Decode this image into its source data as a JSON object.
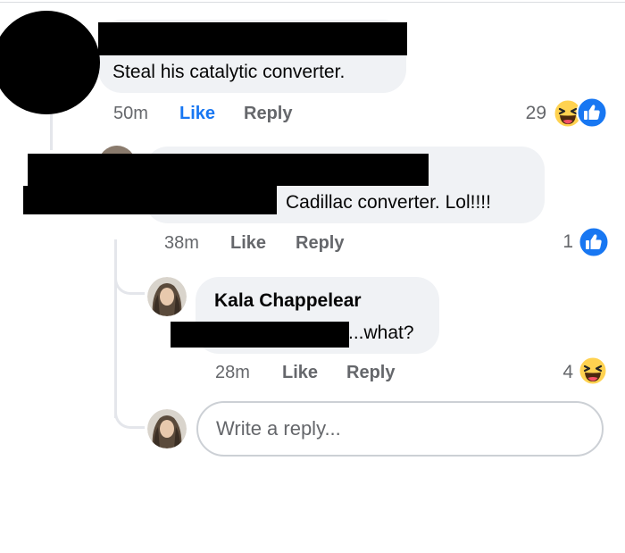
{
  "comment_1": {
    "text": "Steal his catalytic converter.",
    "time": "50m",
    "like_label": "Like",
    "reply_label": "Reply",
    "reaction_count": "29",
    "reaction_icons": [
      "haha-icon",
      "like-icon"
    ],
    "like_color": "#1877f2"
  },
  "comment_2": {
    "text_fragment": "Cadillac converter. Lol!!!!",
    "time": "38m",
    "like_label": "Like",
    "reply_label": "Reply",
    "reaction_count": "1",
    "reaction_icons": [
      "like-icon"
    ]
  },
  "comment_3": {
    "author": "Kala Chappelear",
    "text_fragment": "...what?",
    "time": "28m",
    "like_label": "Like",
    "reply_label": "Reply",
    "reaction_count": "4",
    "reaction_icons": [
      "haha-icon"
    ]
  },
  "reply_input": {
    "placeholder": "Write a reply..."
  }
}
